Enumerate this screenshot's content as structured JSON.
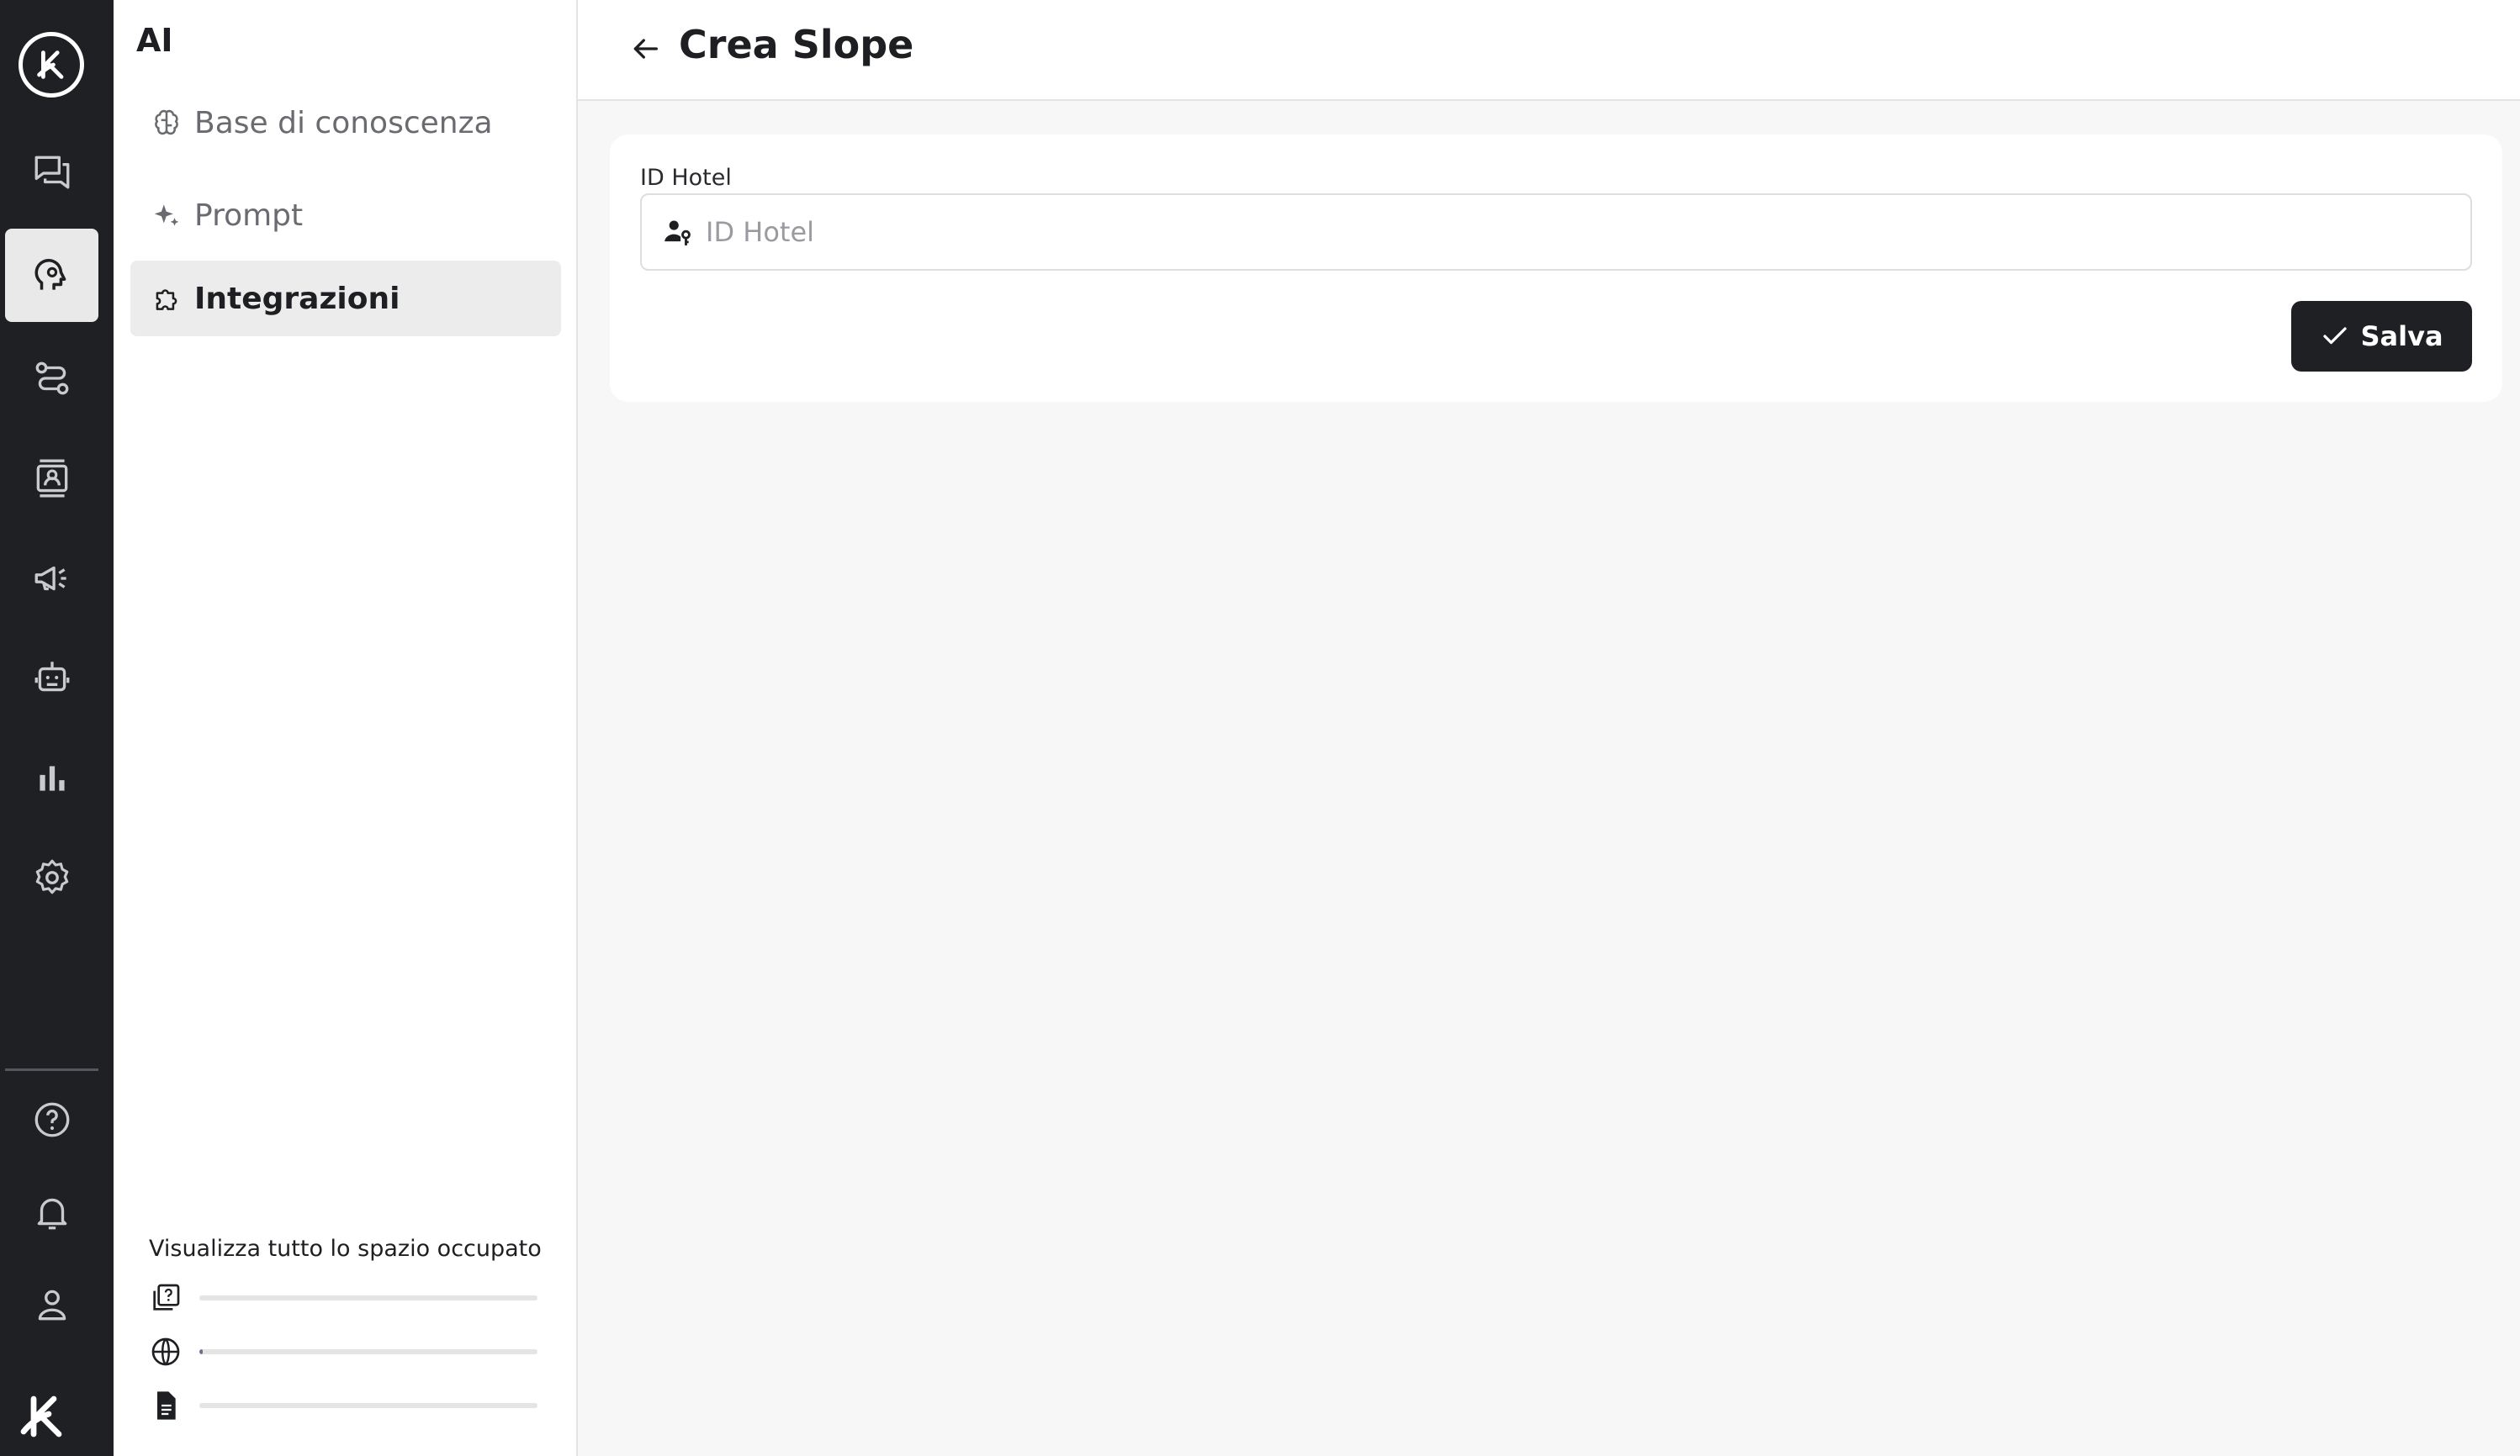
{
  "sidebar": {
    "title": "AI",
    "items": [
      {
        "label": "Base di conoscenza",
        "icon": "brain-icon"
      },
      {
        "label": "Prompt",
        "icon": "sparkles-icon"
      },
      {
        "label": "Integrazioni",
        "icon": "puzzle-icon",
        "active": true
      }
    ],
    "storage": {
      "title": "Visualizza tutto lo spazio occupato",
      "rows": [
        {
          "icon": "faq-icon",
          "usage_percent": 0
        },
        {
          "icon": "globe-icon",
          "usage_percent": 1
        },
        {
          "icon": "document-icon",
          "usage_percent": 0
        }
      ]
    }
  },
  "rail": {
    "items": [
      "chat-icon",
      "ai-head-icon",
      "routes-icon",
      "contacts-icon",
      "megaphone-icon",
      "robot-icon",
      "analytics-icon",
      "settings-icon",
      "help-icon",
      "bell-icon",
      "user-icon"
    ],
    "active": "ai-head-icon"
  },
  "header": {
    "title": "Crea Slope"
  },
  "form": {
    "field_label": "ID Hotel",
    "field_placeholder": "ID Hotel",
    "field_value": "",
    "save_label": "Salva"
  },
  "colors": {
    "rail_bg": "#1f2023",
    "accent": "#1f2023",
    "page_bg": "#f7f7f7",
    "active_nav_bg": "#ececec"
  }
}
